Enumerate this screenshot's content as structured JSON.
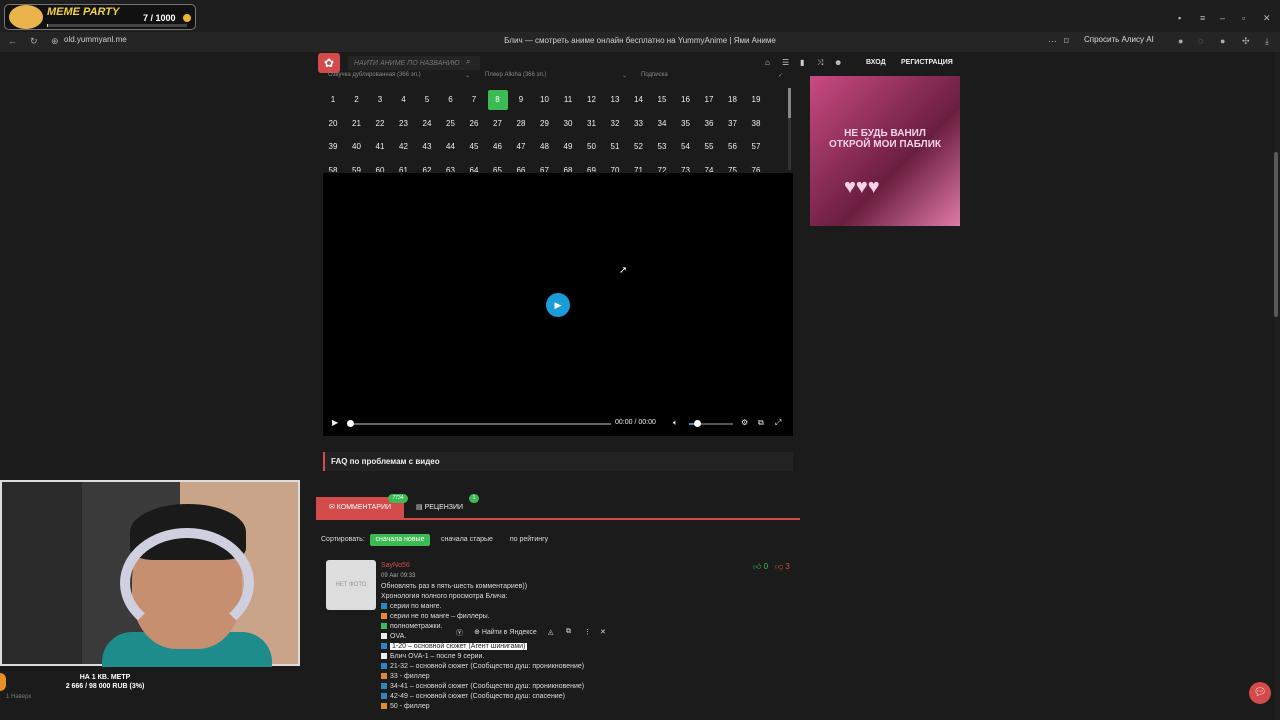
{
  "overlay": {
    "title": "MEME PARTY",
    "progress_text": "7 / 1000",
    "progress_fraction": 0.007
  },
  "browser": {
    "url": "old.yummyanl.me",
    "page_title": "Блич — смотреть аниме онлайн бесплатно на YummyAnime | Ями Аниме",
    "alice": "Спросить Алису AI"
  },
  "site": {
    "logo_icon": "paw-logo",
    "search_placeholder": "НАЙТИ АНИМЕ ПО НАЗВАНИЮ",
    "login": "ВХОД",
    "register": "РЕГИСТРАЦИЯ"
  },
  "dropdowns": {
    "dub": "Озвучка дублированная (366 эп.)",
    "player": "Плеер Alloha (366 эп.)",
    "sub": "Подписка"
  },
  "episodes": {
    "active": 8,
    "rows": [
      [
        "1",
        "2",
        "3",
        "4",
        "5",
        "6",
        "7",
        "8",
        "9",
        "10",
        "11",
        "12",
        "13",
        "14",
        "15",
        "16",
        "17",
        "18",
        "19"
      ],
      [
        "20",
        "21",
        "22",
        "23",
        "24",
        "25",
        "26",
        "27",
        "28",
        "29",
        "30",
        "31",
        "32",
        "33",
        "34",
        "35",
        "36",
        "37",
        "38"
      ],
      [
        "39",
        "40",
        "41",
        "42",
        "43",
        "44",
        "45",
        "46",
        "47",
        "48",
        "49",
        "50",
        "51",
        "52",
        "53",
        "54",
        "55",
        "56",
        "57"
      ],
      [
        "58",
        "59",
        "60",
        "61",
        "62",
        "63",
        "64",
        "65",
        "66",
        "67",
        "68",
        "69",
        "70",
        "71",
        "72",
        "73",
        "74",
        "75",
        "76"
      ]
    ]
  },
  "player": {
    "time": "00:00 / 00:00",
    "volume_fraction": 0.18
  },
  "faq": "FAQ по проблемам с видео",
  "tabs": {
    "comments": "КОММЕНТАРИИ",
    "comments_count": "7734",
    "reviews": "РЕЦЕНЗИИ",
    "reviews_count": "1"
  },
  "sort": {
    "label": "Сортировать:",
    "options": [
      "сначала новые",
      "сначала старые",
      "по рейтингу"
    ]
  },
  "comment": {
    "author": "SayNo56",
    "date": "09 Авг 09:33",
    "avatar_text": "НЕТ ФОТО",
    "likes": "0",
    "dislikes": "3",
    "lines": [
      {
        "text": "Обновлять раз в пять-шесть комментариев))",
        "color": ""
      },
      {
        "text": "Хронология полного просмотра Блича:",
        "color": ""
      },
      {
        "text": "серии по манге.",
        "color": "#2e86c1"
      },
      {
        "text": "серии не по манге – филлеры.",
        "color": "#e08a2e"
      },
      {
        "text": "полнометражки.",
        "color": "#3cba54"
      },
      {
        "text": "OVA.",
        "color": "#eeeeee"
      },
      {
        "text": "1-20 – основной сюжет (Агент шинигами)",
        "color": "#2e86c1"
      },
      {
        "text": "Блич OVA-1 – после 9 серии.",
        "color": "#eeeeee"
      },
      {
        "text": "21-32 – основной сюжет (Сообщество душ: проникновение)",
        "color": "#2e86c1"
      },
      {
        "text": "33 - филлер",
        "color": "#e08a2e"
      },
      {
        "text": "34-41 – основной сюжет (Сообщество душ: проникновение)",
        "color": "#2e86c1"
      },
      {
        "text": "42-49 – основной сюжет (Сообщество душ: спасение)",
        "color": "#2e86c1"
      },
      {
        "text": "50 - филлер",
        "color": "#e08a2e"
      }
    ],
    "selection_popup": "Найти в Яндексе"
  },
  "ad": {
    "text": "НЕ БУДЬ ВАНИЛ ОТКРОЙ МОИ ПАБЛИК",
    "hearts": "♥♥♥"
  },
  "stream": {
    "donation_title": "НА 1 КВ. МЕТР",
    "donation_amount": "2 666 / 98 000 RUB (3%)",
    "donation_fraction": 0.03,
    "bottom": "1 Наверх"
  },
  "colors": {
    "accent": "#d24a4a",
    "green": "#3cba54",
    "play": "#1a9cd8"
  }
}
